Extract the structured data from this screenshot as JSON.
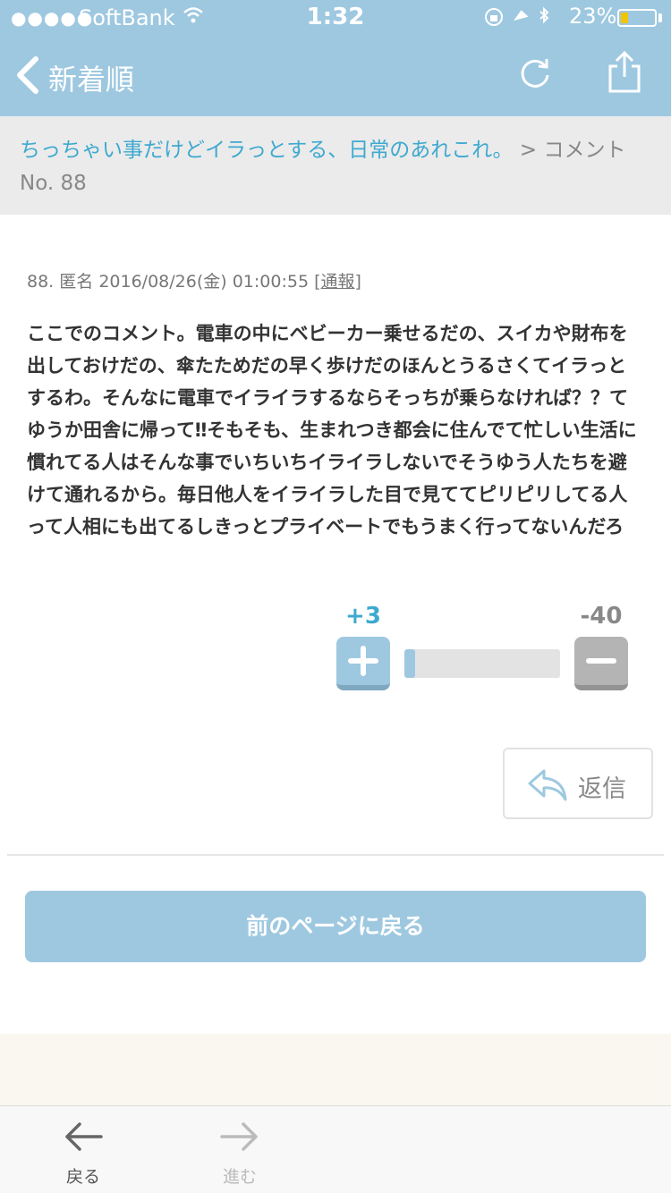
{
  "status_bar": {
    "signal": "●●●●●",
    "carrier": "SoftBank",
    "time": "1:32",
    "battery": "23%",
    "battery_level": 0.23
  },
  "nav": {
    "title": "新着順"
  },
  "breadcrumb": {
    "link": "ちっちゃい事だけどイラっとする、日常のあれこれ。",
    "separator": " > ",
    "current": "コメントNo. 88"
  },
  "comment": {
    "number": "88.",
    "author": "匿名",
    "datetime": "2016/08/26(金) 01:00:55",
    "report_open": "[",
    "report": "通報",
    "report_close": "]",
    "text": "ここでのコメント。電車の中にベビーカー乗せるだの、スイカや財布を出しておけだの、傘たためだの早く歩けだのほんとうるさくてイラっとするわ。そんなに電車でイライラするならそっちが乗らなければ？？てゆうか田舎に帰って‼︎そもそも、生まれつき都会に住んでて忙しい生活に慣れてる人はそんな事でいちいちイライラしないでそうゆう人たちを避けて通れるから。毎日他人をイライラした目で見ててピリピリしてる人って人相にも出てるしきっとプライベートでもうまく行ってないんだろ"
  },
  "votes": {
    "plus": "+3",
    "minus": "-40",
    "plus_ratio": 0.07
  },
  "reply": {
    "label": "返信"
  },
  "prev_page": {
    "label": "前のページに戻る"
  },
  "toolbar": {
    "back": "戻る",
    "forward": "進む"
  },
  "colors": {
    "accent": "#9ec8e0",
    "link": "#3ea9cf"
  }
}
